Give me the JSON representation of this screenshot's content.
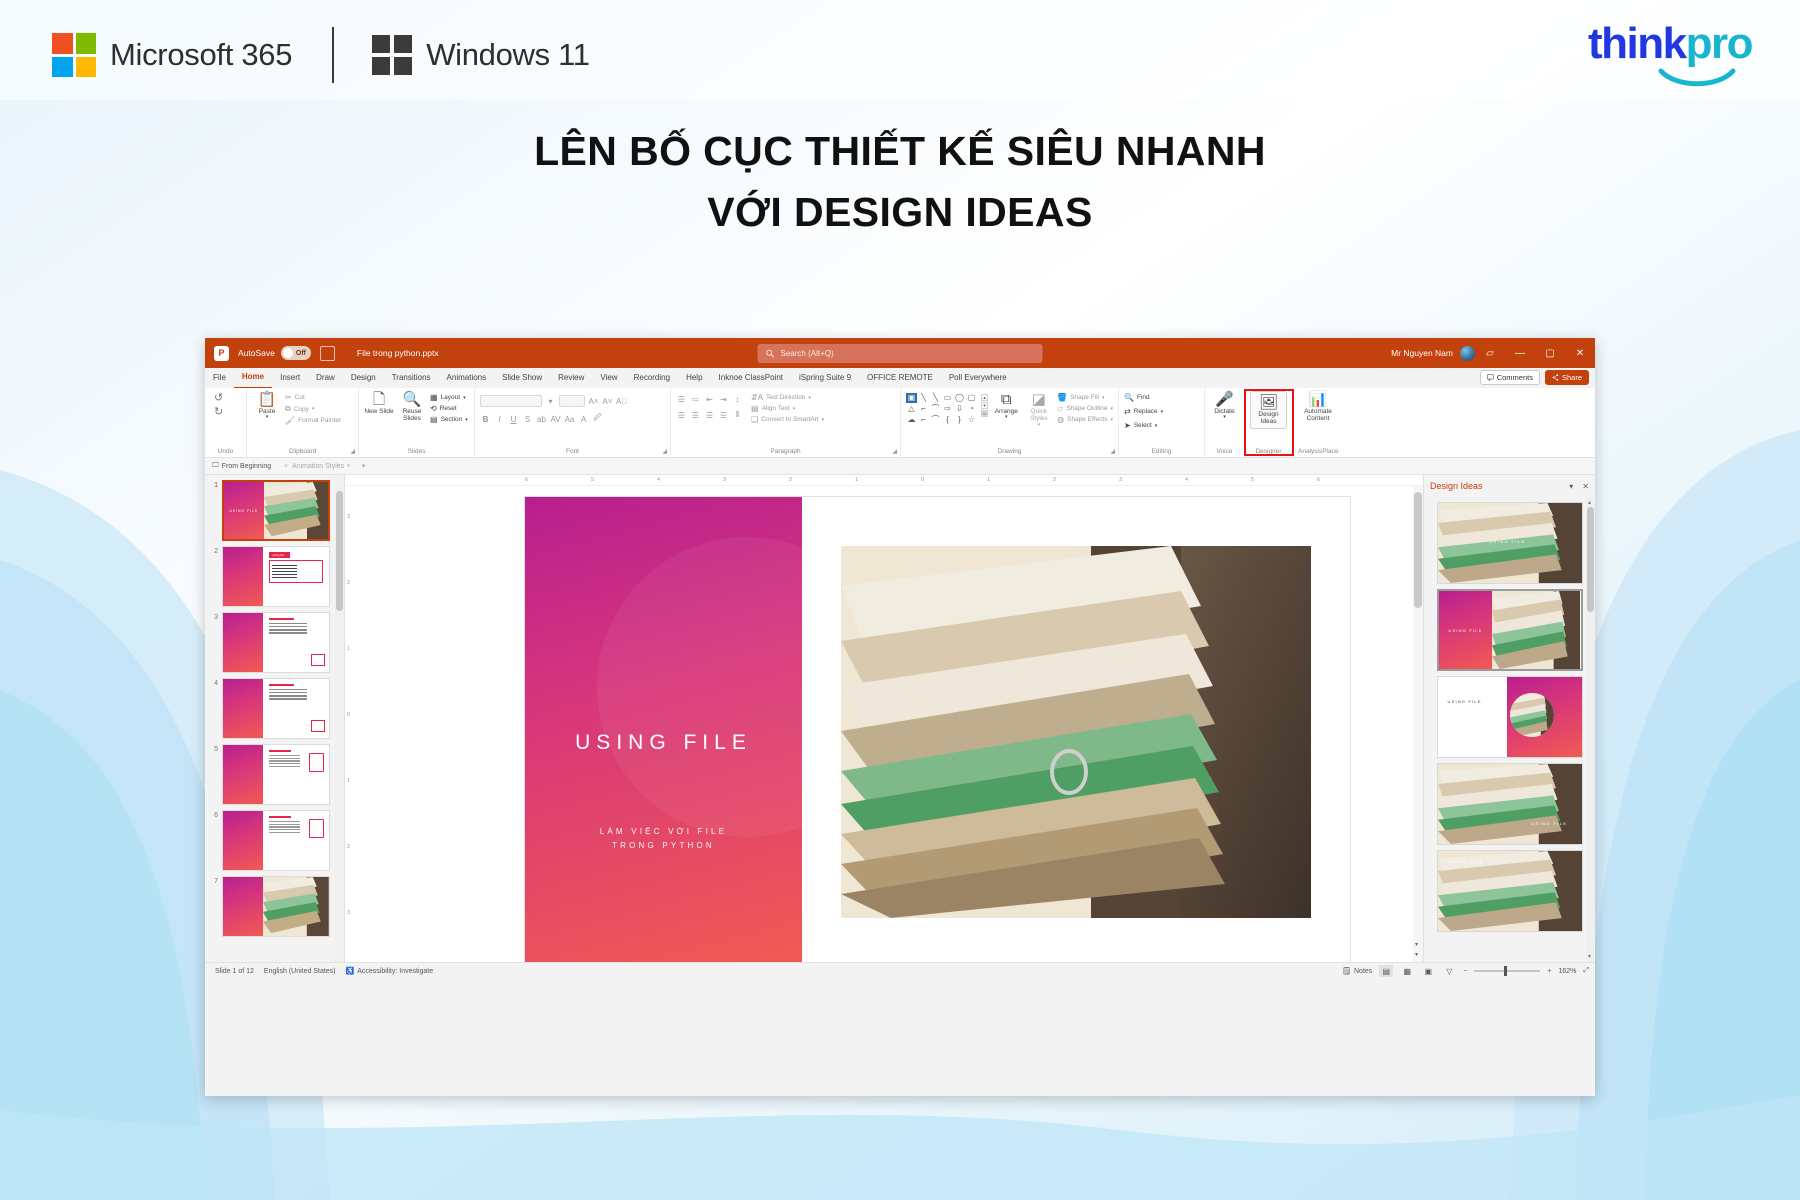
{
  "header": {
    "ms365_label": "Microsoft 365",
    "windows_label": "Windows 11",
    "brand_think": "think",
    "brand_pro": "pro",
    "ms_colors": [
      "#f25022",
      "#7fba00",
      "#00a4ef",
      "#ffb900"
    ],
    "accent": "#2137e0",
    "accent2": "#18b5cf"
  },
  "headline": {
    "line1": "LÊN BỐ CỤC THIẾT KẾ SIÊU NHANH",
    "line2": "VỚI DESIGN IDEAS"
  },
  "ppt": {
    "titlebar": {
      "app_initial": "P",
      "autosave_label": "AutoSave",
      "autosave_state": "Off",
      "filename": "File trong python.pptx",
      "search_placeholder": "Search (Alt+Q)",
      "user": "Mr Nguyen Nam",
      "minimize": "―",
      "maximize": "▢",
      "close": "✕",
      "ribbon_options": "▱",
      "accent_color": "#c2410c"
    },
    "tabs": [
      {
        "label": "File",
        "active": false
      },
      {
        "label": "Home",
        "active": true
      },
      {
        "label": "Insert",
        "active": false
      },
      {
        "label": "Draw",
        "active": false
      },
      {
        "label": "Design",
        "active": false
      },
      {
        "label": "Transitions",
        "active": false
      },
      {
        "label": "Animations",
        "active": false
      },
      {
        "label": "Slide Show",
        "active": false
      },
      {
        "label": "Review",
        "active": false
      },
      {
        "label": "View",
        "active": false
      },
      {
        "label": "Recording",
        "active": false
      },
      {
        "label": "Help",
        "active": false
      },
      {
        "label": "Inknoe ClassPoint",
        "active": false
      },
      {
        "label": "iSpring Suite 9",
        "active": false
      },
      {
        "label": "OFFICE REMOTE",
        "active": false
      },
      {
        "label": "Poll Everywhere",
        "active": false
      }
    ],
    "tabs_right": {
      "comments": "Comments",
      "share": "Share"
    },
    "ribbon": {
      "undo": {
        "name": "Undo",
        "undo_glyph": "↺",
        "redo_glyph": "↻"
      },
      "clipboard": {
        "name": "Clipboard",
        "paste": "Paste",
        "cut": "Cut",
        "copy": "Copy",
        "format_painter": "Format Painter"
      },
      "slides": {
        "name": "Slides",
        "new_slide": "New Slide",
        "reuse_slides": "Reuse Slides",
        "layout": "Layout",
        "reset": "Reset",
        "section": "Section"
      },
      "font": {
        "name": "Font"
      },
      "paragraph": {
        "name": "Paragraph",
        "text_direction": "Text Direction",
        "align_text": "Align Text",
        "convert_smartart": "Convert to SmartArt"
      },
      "drawing": {
        "name": "Drawing",
        "arrange": "Arrange",
        "quick_styles": "Quick Styles",
        "shape_fill": "Shape Fill",
        "shape_outline": "Shape Outline",
        "shape_effects": "Shape Effects"
      },
      "editing": {
        "name": "Editing",
        "find": "Find",
        "replace": "Replace",
        "select": "Select"
      },
      "voice": {
        "name": "Voice",
        "dictate": "Dictate"
      },
      "designer": {
        "name": "Designer",
        "design_ideas": "Design Ideas",
        "highlighted": true,
        "highlight_color": "#e8130f"
      },
      "analysisplace": {
        "name": "AnalysisPlace",
        "automate_content": "Automate Content"
      }
    },
    "quickrow": {
      "from_beginning": "From Beginning",
      "animation_styles": "Animation Styles"
    },
    "thumbnails": [
      {
        "number": "1",
        "selected": true
      },
      {
        "number": "2",
        "selected": false
      },
      {
        "number": "3",
        "selected": false
      },
      {
        "number": "4",
        "selected": false
      },
      {
        "number": "5",
        "selected": false
      },
      {
        "number": "6",
        "selected": false
      },
      {
        "number": "7",
        "selected": false
      }
    ],
    "slide": {
      "title": "USING FILE",
      "subtitle_line1": "LÀM VIỆC VỚI FILE",
      "subtitle_line2": "TRONG PYTHON"
    },
    "ruler": {
      "h_ticks": [
        "6",
        "5",
        "4",
        "3",
        "2",
        "1",
        "0",
        "1",
        "2",
        "3",
        "4",
        "5",
        "6"
      ],
      "v_ticks": [
        "3",
        "2",
        "1",
        "0",
        "1",
        "2",
        "3"
      ]
    },
    "ideas_pane": {
      "title": "Design Ideas",
      "collapse_glyph": "▾",
      "close_glyph": "✕",
      "cards": [
        {
          "id": "idea-1",
          "layout": "photo-full",
          "label": "USING FILE",
          "selected": false
        },
        {
          "id": "idea-2",
          "layout": "split-left",
          "label": "USING FILE",
          "selected": true
        },
        {
          "id": "idea-3",
          "layout": "white-circle",
          "label": "USING FILE",
          "selected": false
        },
        {
          "id": "idea-4",
          "layout": "photo-band",
          "label": "USING FILE",
          "selected": false
        },
        {
          "id": "idea-5",
          "layout": "photo-top",
          "label": "USING FILE",
          "selected": false
        }
      ]
    },
    "statusbar": {
      "slide_count": "Slide 1 of 12",
      "language": "English (United States)",
      "accessibility": "Accessibility: Investigate",
      "notes": "Notes",
      "zoom_level": "162%",
      "zoom_out": "−",
      "zoom_in": "+",
      "fit_glyph": "⤢"
    }
  }
}
